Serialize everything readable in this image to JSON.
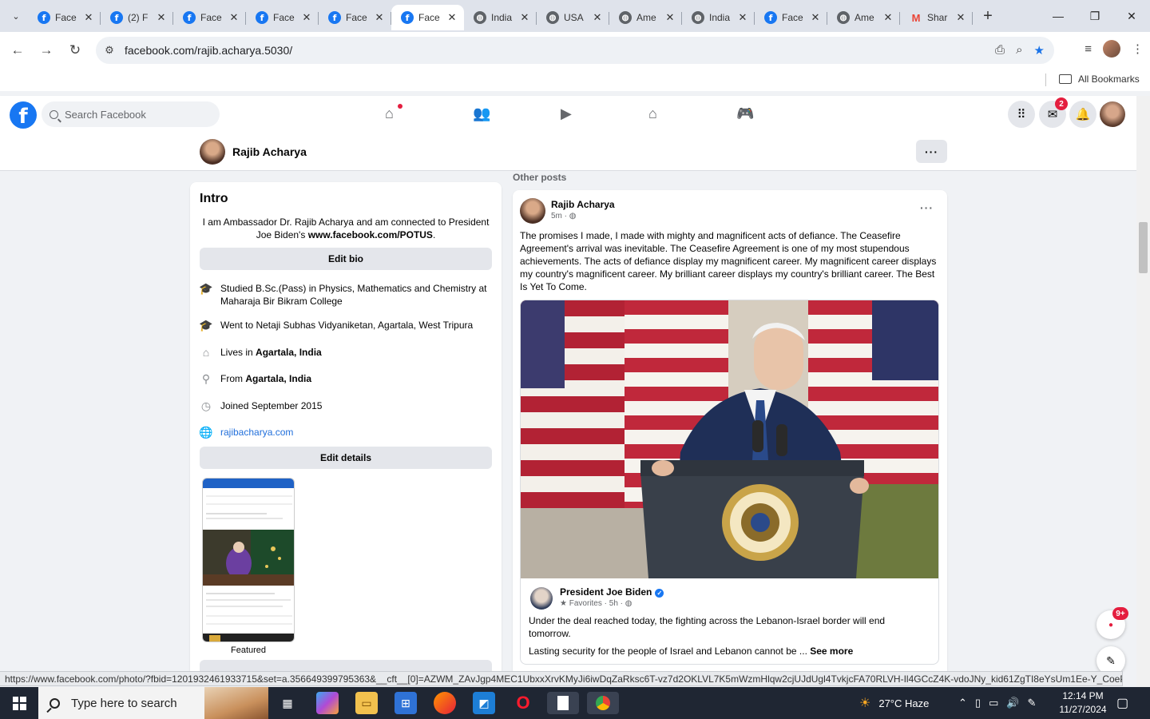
{
  "browser": {
    "tabs": [
      {
        "title": "Face",
        "icon": "facebook-icon"
      },
      {
        "title": "(2) F",
        "icon": "facebook-icon"
      },
      {
        "title": "Face",
        "icon": "facebook-icon"
      },
      {
        "title": "Face",
        "icon": "facebook-icon"
      },
      {
        "title": "Face",
        "icon": "facebook-icon"
      },
      {
        "title": "Face",
        "icon": "facebook-icon",
        "active": true
      },
      {
        "title": "India",
        "icon": "globe-icon"
      },
      {
        "title": "USA",
        "icon": "globe-icon"
      },
      {
        "title": "Ame",
        "icon": "globe-icon"
      },
      {
        "title": "India",
        "icon": "globe-icon"
      },
      {
        "title": "Face",
        "icon": "facebook-icon"
      },
      {
        "title": "Ame",
        "icon": "globe-icon"
      },
      {
        "title": "Shar",
        "icon": "gmail-icon"
      }
    ],
    "url": "facebook.com/rajib.acharya.5030/",
    "bookmarks_label": "All Bookmarks"
  },
  "facebook": {
    "search_placeholder": "Search Facebook",
    "messenger_badge": "2",
    "profile_name": "Rajib Acharya",
    "intro": {
      "title": "Intro",
      "bio_text": "I am Ambassador Dr. Rajib Acharya and am connected to President Joe Biden's ",
      "bio_link": "www.facebook.com/POTUS",
      "bio_end": ".",
      "edit_bio": "Edit bio",
      "details": [
        {
          "icon": "education-icon",
          "text": "Studied B.Sc.(Pass) in Physics, Mathematics and Chemistry at Maharaja Bir Bikram College"
        },
        {
          "icon": "education-icon",
          "text": "Went to Netaji Subhas Vidyaniketan, Agartala, West Tripura"
        },
        {
          "icon": "home-icon",
          "prefix": "Lives in ",
          "bold": "Agartala, India"
        },
        {
          "icon": "location-pin-icon",
          "prefix": "From ",
          "bold": "Agartala, India"
        },
        {
          "icon": "clock-icon",
          "text": "Joined September 2015"
        },
        {
          "icon": "globe-icon",
          "link": "rajibacharya.com"
        }
      ],
      "edit_details": "Edit details",
      "featured_label": "Featured"
    },
    "other_posts_label": "Other posts",
    "post": {
      "author": "Rajib Acharya",
      "time": "5m",
      "text": "The promises I made, I made with mighty and magnificent acts of defiance. The Ceasefire Agreement's arrival was inevitable. The Ceasefire Agreement is one of my most stupendous achievements. The acts of defiance display my magnificent career. My magnificent career displays my country's magnificent career. My brilliant career displays my country's brilliant career.  The Best Is Yet To Come.",
      "shared": {
        "author": "President Joe Biden",
        "meta": "Favorites · 5h ·",
        "text1": "Under the deal reached today, the fighting across the Lebanon-Israel border will end tomorrow.",
        "text2": "Lasting security for the people of Israel and Lebanon cannot be ... ",
        "see_more": "See more"
      }
    },
    "float_badge": "9+"
  },
  "status_url": "https://www.facebook.com/photo/?fbid=1201932461933715&set=a.356649399795363&__cft__[0]=AZWM_ZAvJgp4MEC1UbxxXrvKMyJi6iwDqZaRksc6T-vz7d2OKLVL7K5mWzmHlqw2cjUJdUgl4TvkjcFA70RLVH-Il4GCcZ4K-vdoJNy_kid61ZgTI8eYsUm1Ee-Y_CoePF5Jf...",
  "taskbar": {
    "search_placeholder": "Type here to search",
    "weather": "27°C  Haze",
    "time": "12:14 PM",
    "date": "11/27/2024"
  }
}
